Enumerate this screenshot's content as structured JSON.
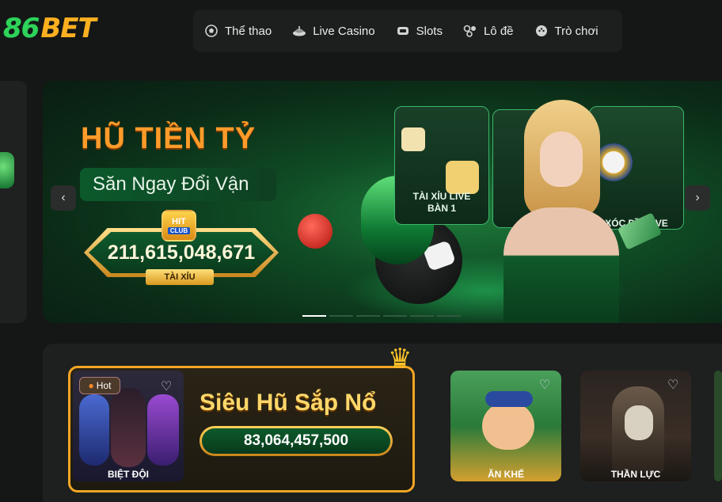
{
  "header": {
    "logo": {
      "part1": "86",
      "part2": "BET"
    },
    "nav": [
      {
        "label": "Thể thao",
        "icon": "soccer-ball-icon"
      },
      {
        "label": "Live Casino",
        "icon": "roulette-icon"
      },
      {
        "label": "Slots",
        "icon": "slot-machine-icon"
      },
      {
        "label": "Lô đề",
        "icon": "lottery-balls-icon"
      },
      {
        "label": "Trò chơi",
        "icon": "gamepad-icon"
      }
    ]
  },
  "banner": {
    "title": "HŨ TIỀN TỶ",
    "subtitle": "Săn Ngay Đổi Vận",
    "jackpot_value": "211,615,048,671",
    "jackpot_logo": "HIT",
    "jackpot_logo_sub": "CLUB",
    "jackpot_tag": "TÀI XỈU",
    "cards": [
      {
        "caption": "TÀI XỈU LIVE BÀN 1"
      },
      {
        "caption": "XÓC ĐĨA LIVE BÀN 1"
      }
    ],
    "slide_count": 6,
    "active_slide": 1
  },
  "promo": {
    "badge": "Hot",
    "game_name": "BIỆT ĐỘI",
    "title": "Siêu Hũ Sắp Nổ",
    "jackpot_value": "83,064,457,500"
  },
  "games": [
    {
      "name": "ĂN KHẾ"
    },
    {
      "name": "THẦN LỰC"
    }
  ],
  "colors": {
    "brand_green": "#2fd35a",
    "brand_orange": "#ffb020",
    "accent_gold": "#f5a623"
  }
}
